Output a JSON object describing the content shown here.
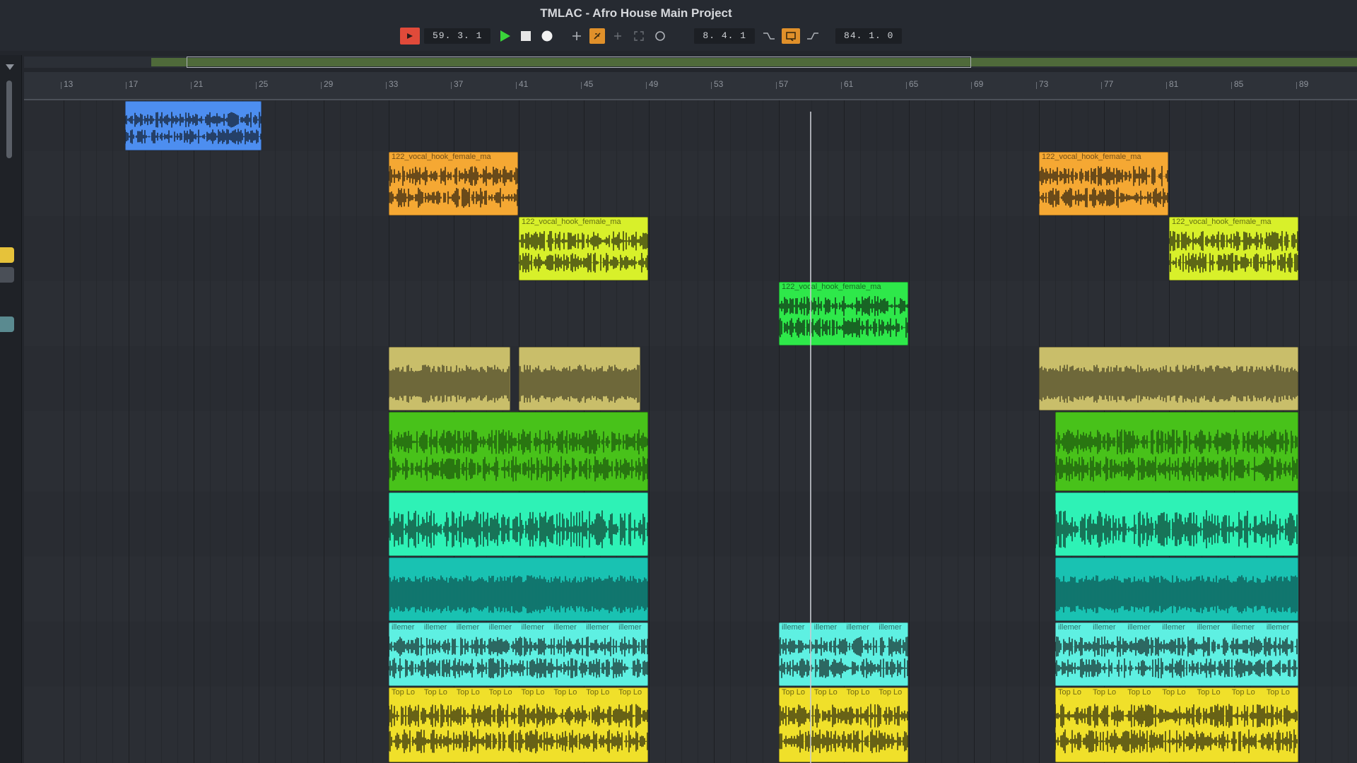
{
  "window": {
    "title": "TMLAC - Afro House Main Project"
  },
  "transport": {
    "position": "59. 3. 1",
    "loop_start": "8. 4. 1",
    "loop_end": "84. 1. 0"
  },
  "ruler": {
    "bars": [
      "13",
      "17",
      "21",
      "25",
      "29",
      "33",
      "37",
      "41",
      "45",
      "49",
      "53",
      "57",
      "61",
      "65",
      "69",
      "73",
      "77",
      "81",
      "85",
      "89"
    ]
  },
  "clips": {
    "vocal_hook": "122_vocal_hook_female_ma",
    "filler": "illemer",
    "top_loop": "Top Lo"
  },
  "colors": {
    "blue": "#4d8ef0",
    "orange": "#f5a833",
    "lime": "#d8f02a",
    "green": "#2ee84a",
    "olive": "#c9be6a",
    "grass": "#48c21a",
    "aqua": "#2ef2b6",
    "teal": "#19c2b2",
    "cyan": "#5ef0e2",
    "yellow": "#f0e02a"
  }
}
